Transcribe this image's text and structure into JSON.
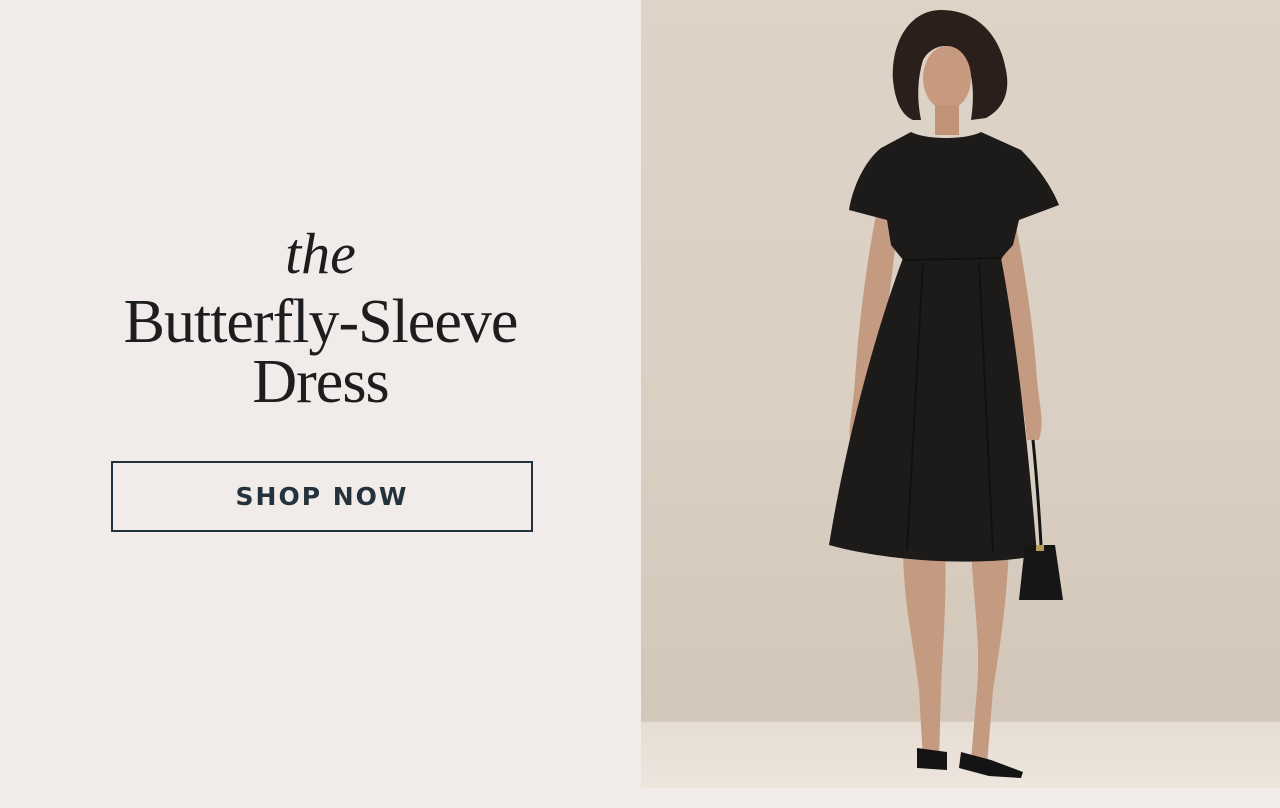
{
  "headline": {
    "prefix": "the",
    "line1": "Butterfly-Sleeve",
    "line2": "Dress"
  },
  "cta": {
    "label": "SHOP NOW"
  },
  "colors": {
    "left_background": "#f1ece9",
    "text": "#1d1d1f",
    "button_border": "#24323d",
    "dress": "#1c1b1a"
  },
  "photo": {
    "icon": "model-in-black-dress-photo"
  }
}
